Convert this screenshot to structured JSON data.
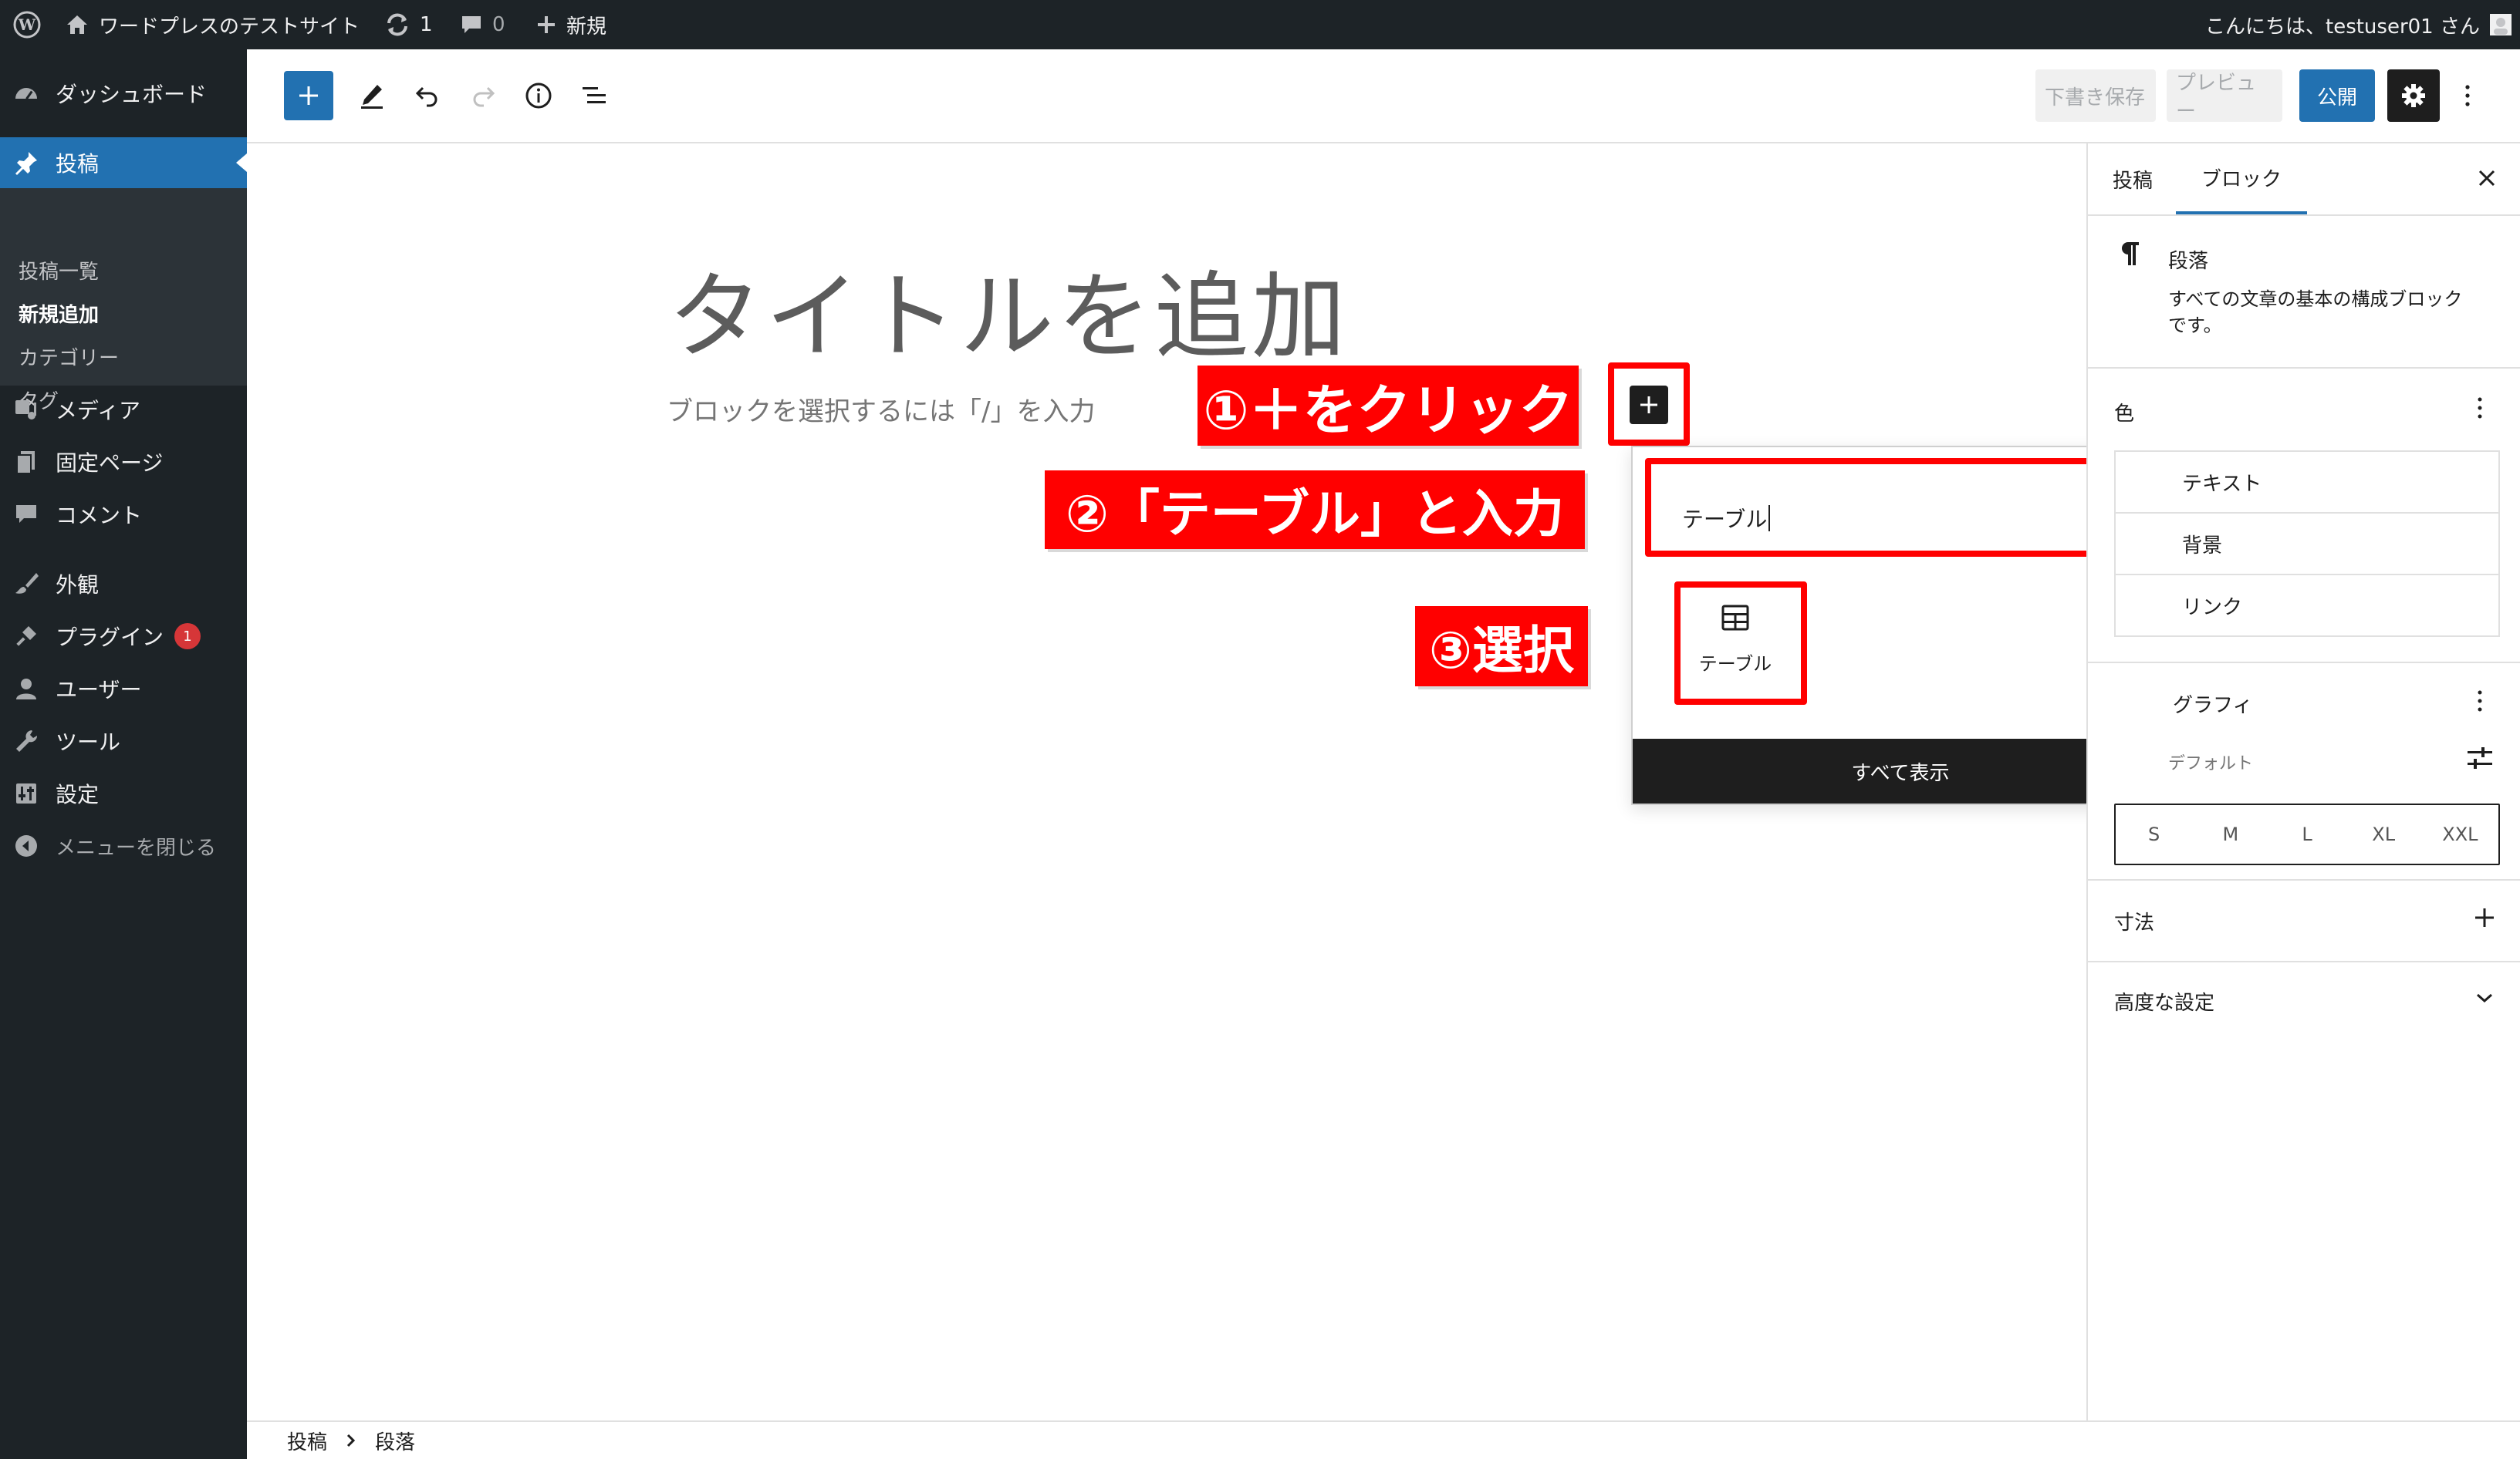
{
  "adminbar": {
    "site_name": "ワードプレスのテストサイト",
    "updates_count": "1",
    "comments_count": "0",
    "new_label": "新規",
    "greeting": "こんにちは、testuser01 さん"
  },
  "sidebar": {
    "dashboard": "ダッシュボード",
    "posts": "投稿",
    "submenu": [
      "投稿一覧",
      "新規追加",
      "カテゴリー",
      "タグ"
    ],
    "media": "メディア",
    "pages": "固定ページ",
    "comments": "コメント",
    "appearance": "外観",
    "plugins": "プラグイン",
    "plugins_badge": "1",
    "users": "ユーザー",
    "tools": "ツール",
    "settings": "設定",
    "collapse": "メニューを閉じる"
  },
  "toolbar": {
    "save_draft": "下書き保存",
    "preview": "プレビュー",
    "publish": "公開"
  },
  "editor": {
    "title_placeholder": "タイトルを追加",
    "paragraph_hint": "ブロックを選択するには「/」を入力"
  },
  "annotations": {
    "step1": "①＋をクリック",
    "step2": "②「テーブル」と入力",
    "step3": "③選択"
  },
  "inserter": {
    "search_value": "テーブル",
    "result_label": "テーブル",
    "show_all": "すべて表示"
  },
  "settings_panel": {
    "tab_post": "投稿",
    "tab_block": "ブロック",
    "block_name": "段落",
    "block_desc_line1": "すべての文章の基本の構成ブロック",
    "block_desc_line2": "です。",
    "color_title": "色",
    "color_items": [
      "テキスト",
      "背景",
      "リンク"
    ],
    "typography_title": "グラフィ",
    "font_size_label": "デフォルト",
    "sizes": [
      "S",
      "M",
      "L",
      "XL",
      "XXL"
    ],
    "dimensions": "寸法",
    "advanced": "高度な設定"
  },
  "breadcrumb": {
    "root": "投稿",
    "current": "段落"
  },
  "colors": {
    "admin_dark": "#1d2327",
    "wp_blue": "#2271b1",
    "annotation_red": "#ff0000"
  }
}
